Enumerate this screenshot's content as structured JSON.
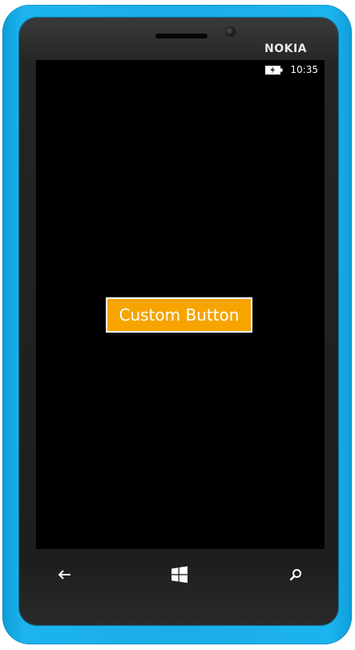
{
  "device": {
    "brand": "NOKIA",
    "body_color": "#1aaee8"
  },
  "status_bar": {
    "time": "10:35",
    "battery_icon": "battery-charging-icon"
  },
  "screen": {
    "background": "#000000",
    "button": {
      "label": "Custom Button",
      "background": "#f7a400",
      "border": "#ffffff"
    }
  },
  "nav": {
    "back_icon": "back-arrow-icon",
    "start_icon": "windows-start-icon",
    "search_icon": "search-icon"
  }
}
